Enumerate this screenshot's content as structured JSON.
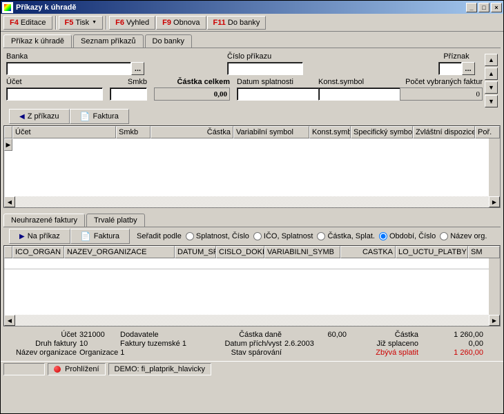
{
  "window": {
    "title": "Příkazy k úhradě"
  },
  "toolbar": {
    "edit_fkey": "F4",
    "edit_label": "Editace",
    "print_fkey": "F5",
    "print_label": "Tisk",
    "view_fkey": "F6",
    "view_label": "Vyhled",
    "refresh_fkey": "F9",
    "refresh_label": "Obnova",
    "bank_fkey": "F11",
    "bank_label": "Do banky"
  },
  "tabs": {
    "t1": "Příkaz k úhradě",
    "t2": "Seznam příkazů",
    "t3": "Do banky"
  },
  "form": {
    "bank_label": "Banka",
    "orderno_label": "Číslo příkazu",
    "flag_label": "Příznak",
    "account_label": "Účet",
    "smkb_label": "Smkb",
    "total_label": "Částka celkem",
    "total_value": "0,00",
    "due_label": "Datum splatnosti",
    "const_label": "Konst.symbol",
    "count_label": "Počet vybraných faktur",
    "count_value": "0"
  },
  "gridbtns": {
    "fromorder": "Z příkazu",
    "invoice": "Faktura"
  },
  "grid1_cols": {
    "c0": "Účet",
    "c1": "Smkb",
    "c2": "Částka",
    "c3": "Variabilní symbol",
    "c4": "Konst.symb",
    "c5": "Specifický symbo",
    "c6": "Zvláštní dispozice",
    "c7": "Poř."
  },
  "tabs2": {
    "t1": "Neuhrazené faktury",
    "t2": "Trvalé platby"
  },
  "grid2btns": {
    "toorder": "Na příkaz",
    "invoice": "Faktura"
  },
  "sort_label": "Seřadit podle",
  "sort_opts": {
    "o1": "Splatnost, Číslo",
    "o2": "IČO, Splatnost",
    "o3": "Částka, Splat.",
    "o4": "Období, Číslo",
    "o5": "Název org."
  },
  "grid2_cols": {
    "c0": "ICO_ORGAN",
    "c1": "NAZEV_ORGANIZACE",
    "c2": "DATUM_SF",
    "c3": "CISLO_DOKL",
    "c4": "VARIABILNI_SYMB",
    "c5": "CASTKA",
    "c6": "LO_UCTU_PLATBY",
    "c7": "SM"
  },
  "summary": {
    "account_lbl": "Účet",
    "account_val": "321000",
    "account_desc": "Dodavatele",
    "invtype_lbl": "Druh faktury",
    "invtype_val": "10",
    "invtype_desc": "Faktury tuzemské 1",
    "orgname_lbl": "Název organizace",
    "orgname_val": "Organizace 1",
    "taxamt_lbl": "Částka daně",
    "taxamt_val": "60,00",
    "datein_lbl": "Datum přích/vyst",
    "datein_val": "2.6.2003",
    "pairstat_lbl": "Stav spárování",
    "pairstat_val": "",
    "amount_lbl": "Částka",
    "amount_val": "1 260,00",
    "paid_lbl": "Již splaceno",
    "paid_val": "0,00",
    "remain_lbl": "Zbývá splatit",
    "remain_val": "1 260,00"
  },
  "status": {
    "mode": "Prohlížení",
    "demo": "DEMO: fi_platprik_hlavicky"
  }
}
